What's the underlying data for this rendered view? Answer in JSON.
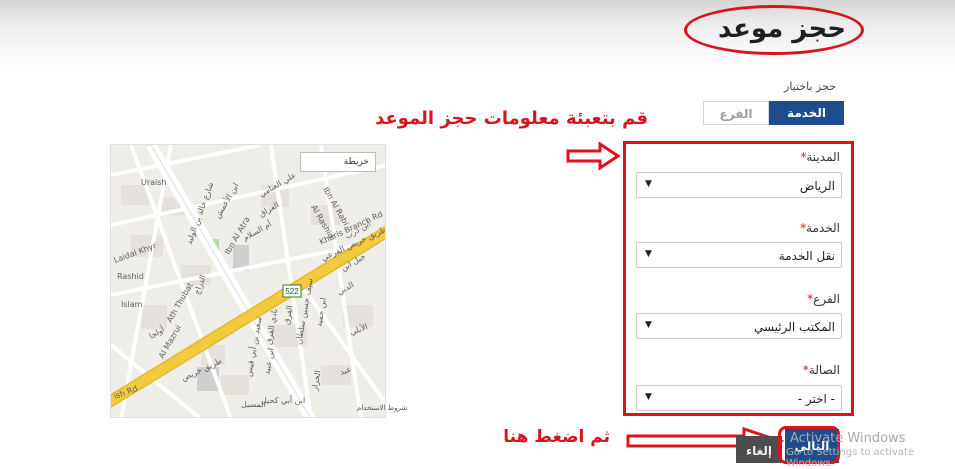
{
  "page": {
    "title": "حجز موعد",
    "booking_by_label": "حجز باختيار"
  },
  "tabs": [
    {
      "label": "الخدمة",
      "active": true
    },
    {
      "label": "الفرع",
      "active": false
    }
  ],
  "annotations": {
    "fill_info": "قم بتعبئة معلومات حجز الموعد",
    "then_click": "ثم اضغط هنا"
  },
  "form": {
    "fields": [
      {
        "label": "المدينة",
        "value": "الرياض"
      },
      {
        "label": "الخدمة",
        "value": "نقل الخدمة"
      },
      {
        "label": "الفرع",
        "value": "المكتب الرئيسي"
      },
      {
        "label": "الصالة",
        "value": "- اختر -"
      }
    ],
    "required_mark": "*",
    "dropdown_caret": "▼"
  },
  "map": {
    "map_button": "خريطة",
    "terms": "شروط الاستخدام",
    "road_sign": "522",
    "streets": [
      "Uraish",
      "Laidal Khyr",
      "Rashid",
      "Islam",
      "Ath Thubat",
      "Al Mazrui",
      "Ibn Al Atra",
      "Al Rashid",
      "Ibn Al Rabi",
      "Kharis Branch Rd",
      "طريق خريص الفرعي",
      "طريق خريص",
      "شارع خالد بن الوليد",
      "ish Rd",
      "العراق",
      "علي العنامي",
      "ابن الأعمش",
      "أم السلام",
      "الفرق",
      "نادي الفرق",
      "ابن عبيد",
      "ابن حميد",
      "سيف حسين سلطان",
      "سعيد بن أبي قيس",
      "ابن أبي كحيل",
      "الدبي",
      "جبل ابن",
      "الأبلي",
      "عبد",
      "الخراز",
      "المسيل",
      "أولجا",
      "الدراج",
      "ابن ذرب"
    ]
  },
  "buttons": {
    "cancel": "إلغاء",
    "next": "التالي"
  },
  "watermark": {
    "line1": "Activate Windows",
    "line2": "Go to Settings to activate Windows."
  },
  "colors": {
    "accent_red": "#d9141c",
    "primary_blue": "#1d4d8a",
    "map_highway": "#f4cb3c"
  },
  "icons": {
    "arrow": "hollow-right-arrow"
  }
}
